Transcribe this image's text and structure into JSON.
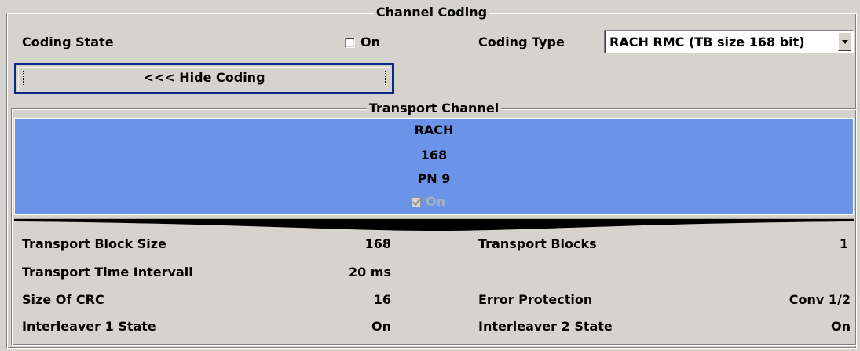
{
  "channel_coding": {
    "title": "Channel Coding",
    "coding_state_label": "Coding State",
    "coding_state_checkbox_label": "On",
    "coding_state_checked": false,
    "coding_type_label": "Coding Type",
    "coding_type_value": "RACH RMC (TB size 168 bit)",
    "hide_coding_button": "<<< Hide Coding"
  },
  "transport_channel": {
    "title": "Transport Channel",
    "selected_item": {
      "name": "RACH",
      "size": "168",
      "data": "PN 9",
      "state_label": "On",
      "state_checked": true
    },
    "params": {
      "transport_block_size_label": "Transport Block Size",
      "transport_block_size_value": "168",
      "transport_blocks_label": "Transport Blocks",
      "transport_blocks_value": "1",
      "tti_label": "Transport Time Intervall",
      "tti_value": "20 ms",
      "crc_label": "Size Of CRC",
      "crc_value": "16",
      "error_protection_label": "Error Protection",
      "error_protection_value": "Conv 1/2",
      "interleaver1_label": "Interleaver 1 State",
      "interleaver1_value": "On",
      "interleaver2_label": "Interleaver 2 State",
      "interleaver2_value": "On"
    }
  },
  "colors": {
    "background": "#d6d3ce",
    "selection_blue": "#6b94e8",
    "focus_border": "#0b2a8a"
  },
  "icons": {
    "dropdown": "chevron-down-icon"
  }
}
